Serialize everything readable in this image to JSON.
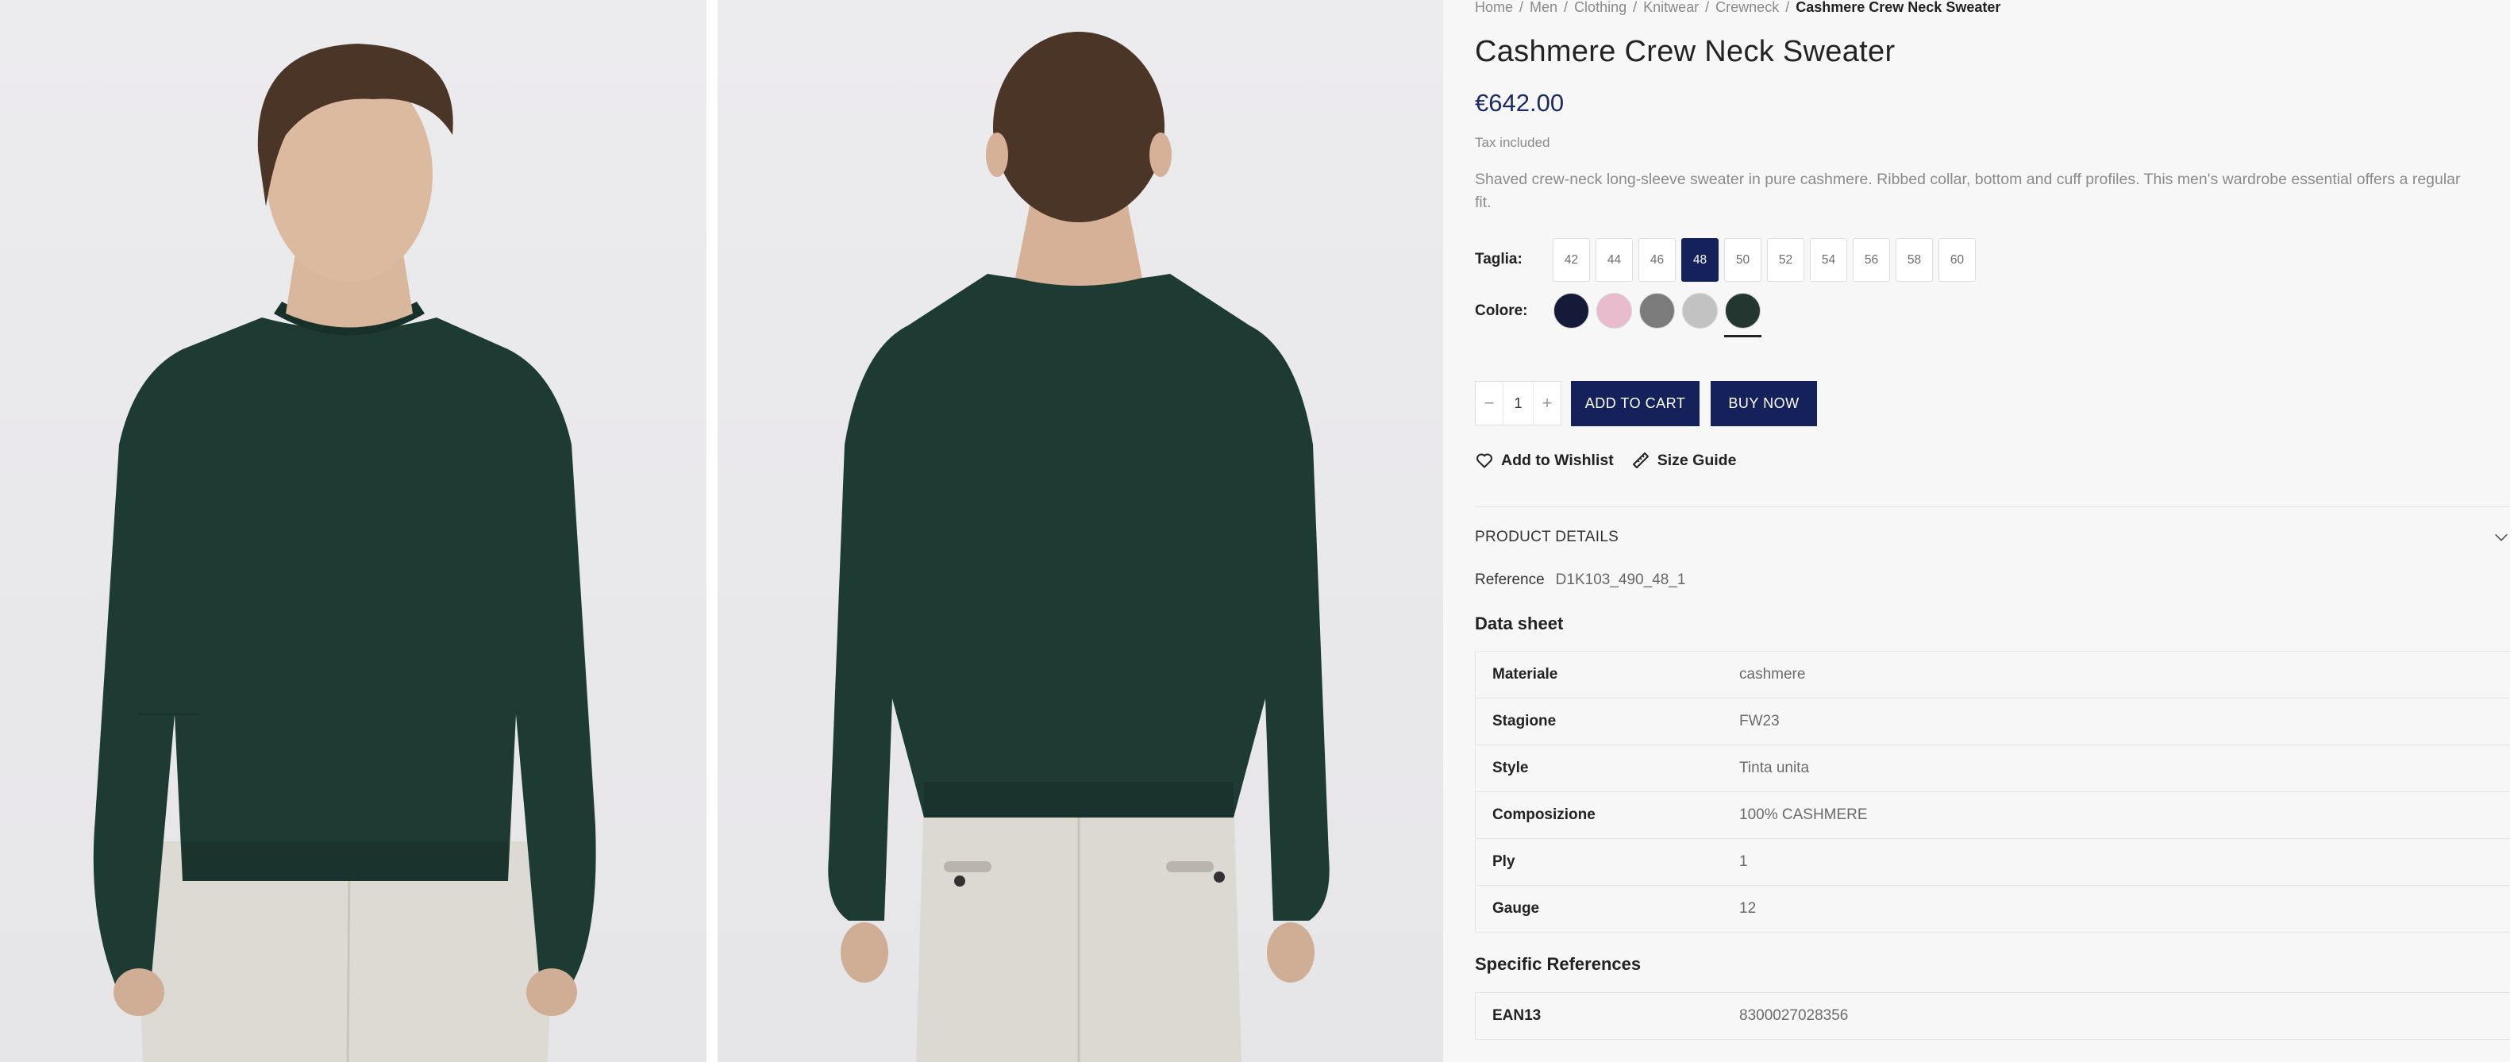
{
  "breadcrumb": {
    "items": [
      "Home",
      "Men",
      "Clothing",
      "Knitwear",
      "Crewneck"
    ],
    "current": "Cashmere Crew Neck Sweater",
    "separator": "/"
  },
  "product": {
    "title": "Cashmere Crew Neck Sweater",
    "price": "€642.00",
    "tax_note": "Tax included",
    "description": "Shaved crew-neck long-sleeve sweater in pure cashmere. Ribbed collar, bottom and cuff profiles. This men's wardrobe essential offers a regular fit."
  },
  "options": {
    "size_label": "Taglia:",
    "sizes": [
      "42",
      "44",
      "46",
      "48",
      "50",
      "52",
      "54",
      "56",
      "58",
      "60"
    ],
    "selected_size": "48",
    "color_label": "Colore:",
    "colors": [
      "#141a38",
      "#e8bccd",
      "#7b7b7b",
      "#c2c2c2",
      "#233630"
    ],
    "selected_color_index": 4
  },
  "purchase": {
    "minus": "−",
    "quantity": "1",
    "plus": "+",
    "add_to_cart": "ADD TO CART",
    "buy_now": "BUY NOW"
  },
  "links": {
    "wishlist": "Add to Wishlist",
    "size_guide": "Size Guide"
  },
  "details": {
    "heading": "PRODUCT DETAILS",
    "reference_label": "Reference",
    "reference_value": "D1K103_490_48_1",
    "data_sheet_title": "Data sheet",
    "data_sheet": [
      {
        "key": "Materiale",
        "value": "cashmere"
      },
      {
        "key": "Stagione",
        "value": "FW23"
      },
      {
        "key": "Style",
        "value": "Tinta unita"
      },
      {
        "key": "Composizione",
        "value": "100% CASHMERE"
      },
      {
        "key": "Ply",
        "value": "1"
      },
      {
        "key": "Gauge",
        "value": "12"
      }
    ],
    "specific_refs_title": "Specific References",
    "specific_refs": [
      {
        "key": "EAN13",
        "value": "8300027028356"
      }
    ]
  },
  "theme": {
    "accent": "#14215a",
    "price_color": "#1b2a63",
    "sweater_color": "#1e3b33",
    "trousers_color": "#dcd9d2"
  },
  "icons": [
    "heart-icon",
    "ruler-icon",
    "chevron-down-icon"
  ]
}
